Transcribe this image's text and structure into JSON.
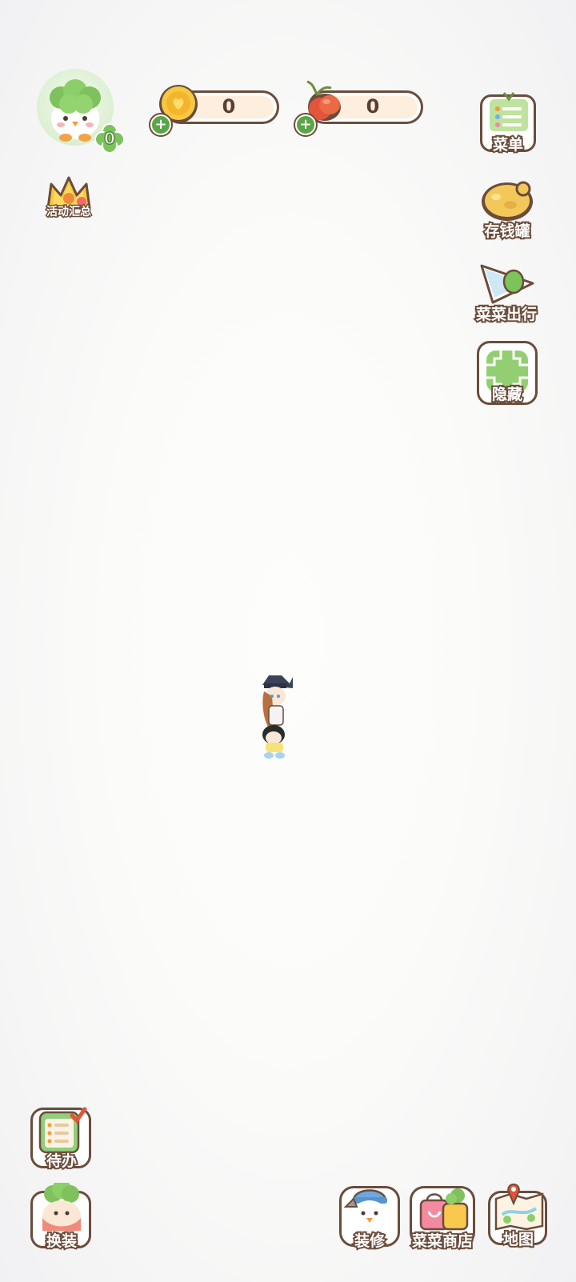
{
  "player": {
    "level": "0"
  },
  "currencies": {
    "coins": "0",
    "carrots": "0"
  },
  "left_menu": {
    "events_label": "活动汇总"
  },
  "right_menu": {
    "menu_label": "菜单",
    "piggy_bank_label": "存钱罐",
    "travel_label": "菜菜出行",
    "hide_label": "隐藏"
  },
  "bottom_left": {
    "todo_label": "待办",
    "dress_up_label": "换装"
  },
  "bottom_right": {
    "decorate_label": "装修",
    "shop_label": "菜菜商店",
    "map_label": "地图"
  },
  "colors": {
    "outline": "#6b4c3b",
    "leaf_green": "#5aa646",
    "coin_gold": "#f5c33b",
    "carrot_red": "#e2553b"
  }
}
